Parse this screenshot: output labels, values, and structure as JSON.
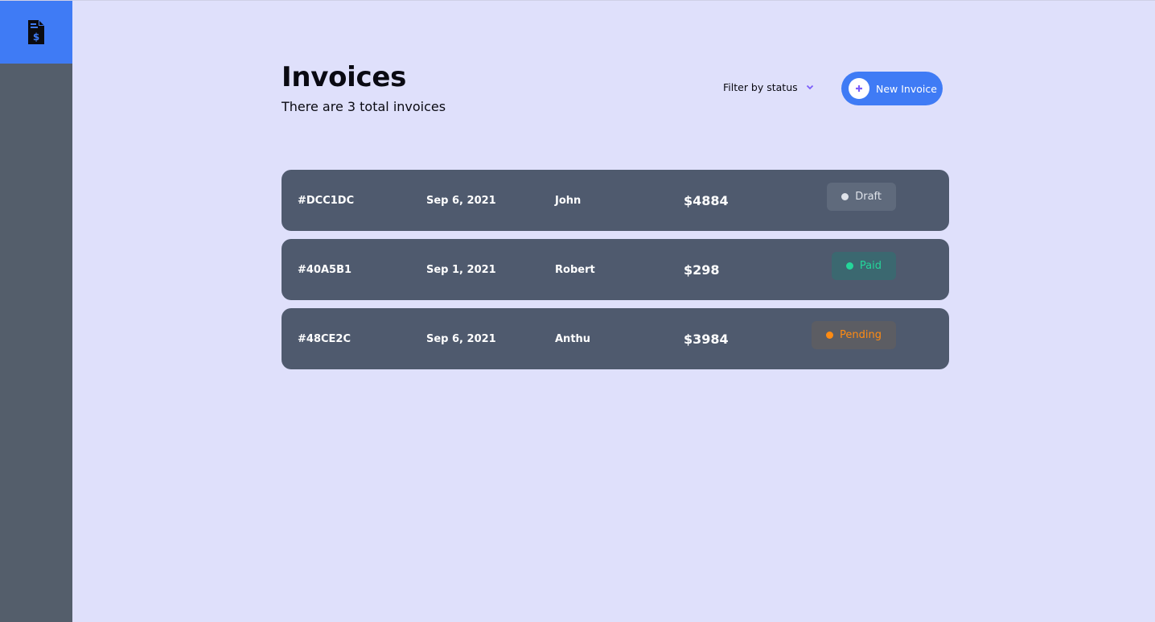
{
  "sidebar": {
    "logo_icon": "invoice-dollar-icon"
  },
  "header": {
    "title": "Invoices",
    "subtitle": "There are 3 total invoices"
  },
  "filter": {
    "label": "Filter by status",
    "icon": "chevron-down-icon"
  },
  "new_invoice": {
    "label": "New Invoice",
    "icon": "plus-icon"
  },
  "invoices": [
    {
      "id": "#DCC1DC",
      "date": "Sep 6, 2021",
      "client": "John",
      "amount": "$4884",
      "status": "Draft"
    },
    {
      "id": "#40A5B1",
      "date": "Sep 1, 2021",
      "client": "Robert",
      "amount": "$298",
      "status": "Paid"
    },
    {
      "id": "#48CE2C",
      "date": "Sep 6, 2021",
      "client": "Anthu",
      "amount": "$3984",
      "status": "Pending"
    }
  ],
  "colors": {
    "accent": "#3f7bf5",
    "background": "#dfe0fb",
    "sidebar": "#545e6b",
    "row": "#4f5a6e",
    "draft": "#dfe3ea",
    "paid": "#24d69a",
    "pending": "#ff8b12"
  }
}
